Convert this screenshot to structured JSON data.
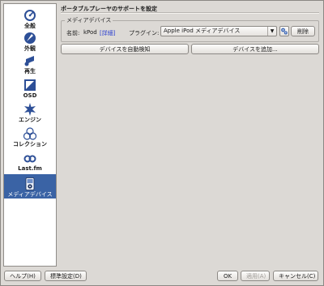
{
  "page": {
    "heading": "ポータブルプレーヤのサポートを設定"
  },
  "sidebar": {
    "items": [
      {
        "label": "全般",
        "icon": "general-icon"
      },
      {
        "label": "外観",
        "icon": "appearance-icon"
      },
      {
        "label": "再生",
        "icon": "playback-icon"
      },
      {
        "label": "OSD",
        "icon": "osd-icon"
      },
      {
        "label": "エンジン",
        "icon": "engine-icon"
      },
      {
        "label": "コレクション",
        "icon": "collection-icon"
      },
      {
        "label": "Last.fm",
        "icon": "lastfm-icon"
      },
      {
        "label": "メディアデバイス",
        "icon": "media-device-icon",
        "selected": true
      }
    ]
  },
  "media_device": {
    "group_title": "メディアデバイス",
    "name_label": "名前:",
    "name_value": "kPod",
    "details_link": "[詳細]",
    "plugin_label": "プラグイン:",
    "plugin_value": "Apple iPod メディアデバイス",
    "delete_label": "削除",
    "autodetect_label": "デバイスを自動検知",
    "add_device_label": "デバイスを追加..."
  },
  "footer": {
    "help_label": "ヘルプ(H)",
    "defaults_label": "標準設定(D)",
    "ok_label": "OK",
    "apply_label": "適用(A)",
    "cancel_label": "キャンセル(C)"
  },
  "colors": {
    "selection": "#3a63a5",
    "link": "#2b3fd0"
  }
}
